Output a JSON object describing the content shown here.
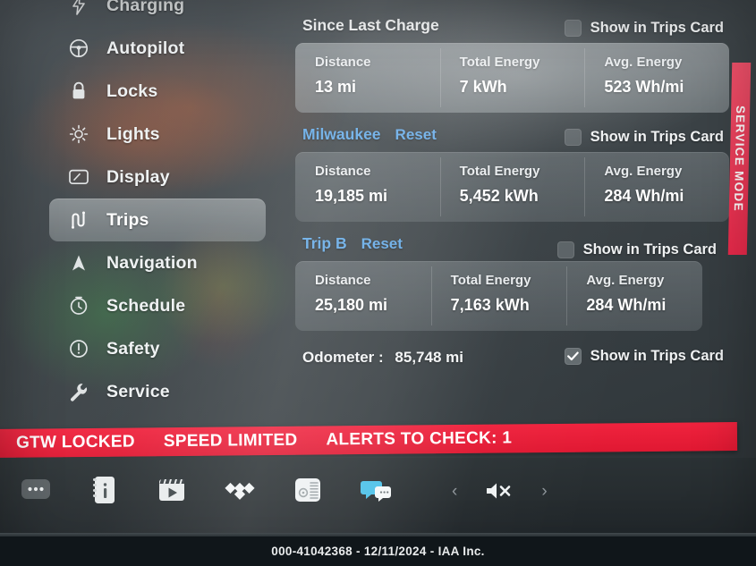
{
  "sidebar": {
    "items": [
      {
        "label": "Charging",
        "icon": "charging-bolt-icon",
        "selected": false,
        "clipped": true
      },
      {
        "label": "Autopilot",
        "icon": "steering-wheel-icon",
        "selected": false
      },
      {
        "label": "Locks",
        "icon": "padlock-icon",
        "selected": false
      },
      {
        "label": "Lights",
        "icon": "sun-brightness-icon",
        "selected": false
      },
      {
        "label": "Display",
        "icon": "display-screen-icon",
        "selected": false
      },
      {
        "label": "Trips",
        "icon": "trips-road-icon",
        "selected": true
      },
      {
        "label": "Navigation",
        "icon": "navigation-arrow-icon",
        "selected": false
      },
      {
        "label": "Schedule",
        "icon": "clock-schedule-icon",
        "selected": false
      },
      {
        "label": "Safety",
        "icon": "exclamation-circle-icon",
        "selected": false
      },
      {
        "label": "Service",
        "icon": "wrench-icon",
        "selected": false
      }
    ]
  },
  "main": {
    "show_in_trips_card_label": "Show in Trips Card",
    "reset_label": "Reset",
    "sections": [
      {
        "title": "Since Last Charge",
        "title_is_link": false,
        "has_reset": false,
        "checked": false,
        "stats": [
          {
            "label": "Distance",
            "value": "13 mi"
          },
          {
            "label": "Total Energy",
            "value": "7 kWh"
          },
          {
            "label": "Avg. Energy",
            "value": "523 Wh/mi"
          }
        ]
      },
      {
        "title": "Milwaukee",
        "title_is_link": true,
        "has_reset": true,
        "checked": false,
        "stats": [
          {
            "label": "Distance",
            "value": "19,185 mi"
          },
          {
            "label": "Total Energy",
            "value": "5,452 kWh"
          },
          {
            "label": "Avg. Energy",
            "value": "284 Wh/mi"
          }
        ]
      },
      {
        "title": "Trip B",
        "title_is_link": true,
        "has_reset": true,
        "checked": false,
        "stats": [
          {
            "label": "Distance",
            "value": "25,180 mi"
          },
          {
            "label": "Total Energy",
            "value": "7,163 kWh"
          },
          {
            "label": "Avg. Energy",
            "value": "284 Wh/mi"
          }
        ]
      }
    ],
    "odometer": {
      "label": "Odometer :",
      "value": "85,748 mi",
      "checked": true
    }
  },
  "service_mode": {
    "label": "SERVICE MODE",
    "color": "#ec2c4a"
  },
  "alert_bar": {
    "color": "#e51d37",
    "messages": [
      "GTW LOCKED",
      "SPEED LIMITED",
      "ALERTS TO CHECK: 1"
    ]
  },
  "taskbar": {
    "left_icons": [
      {
        "name": "more-ellipsis-icon"
      },
      {
        "name": "owners-manual-info-icon"
      },
      {
        "name": "theater-video-icon"
      },
      {
        "name": "tidal-music-icon"
      },
      {
        "name": "radio-tuner-icon"
      },
      {
        "name": "messages-chat-icon"
      }
    ],
    "right_controls": [
      {
        "name": "previous-track-chevron-icon",
        "glyph": "‹"
      },
      {
        "name": "volume-muted-icon",
        "glyph": ""
      },
      {
        "name": "next-track-chevron-icon",
        "glyph": "›"
      }
    ]
  },
  "footer": {
    "watermark": "000-41042368 - 12/11/2024 - IAA Inc."
  },
  "colors": {
    "accent_link": "#63a9e6",
    "alert_red": "#e51d37",
    "service_red": "#ec2c4a",
    "card_fill": "#8d9599"
  }
}
